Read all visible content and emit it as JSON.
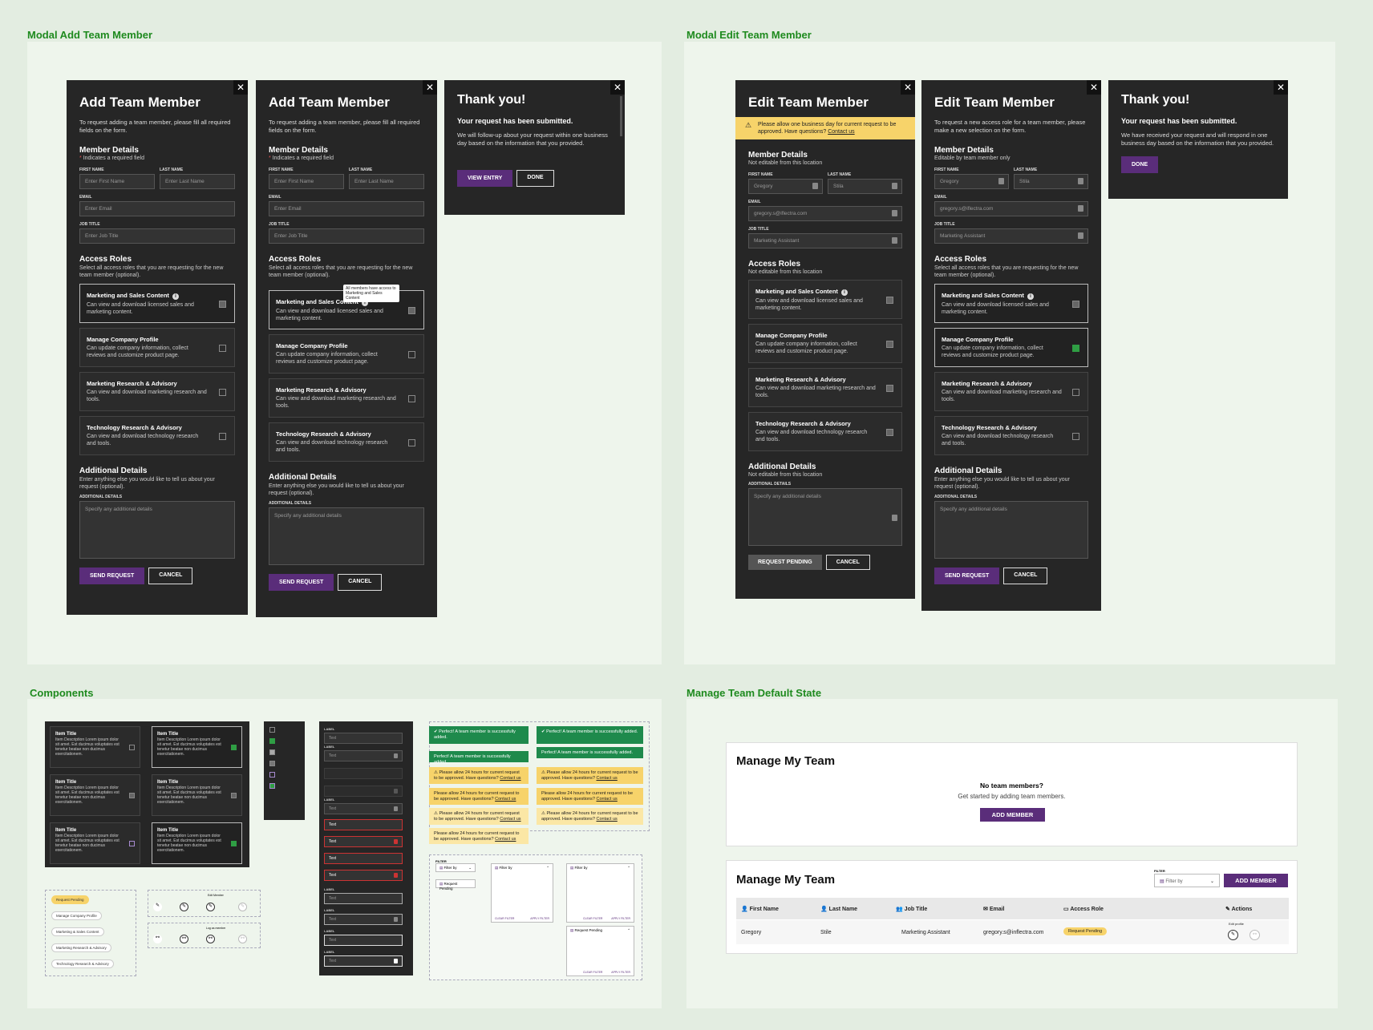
{
  "frames": {
    "add": "Modal Add Team Member",
    "edit": "Modal Edit Team Member",
    "components": "Components",
    "manage": "Manage Team Default State"
  },
  "add_modal": {
    "title": "Add Team Member",
    "subtitle": "To request adding a team member, please fill all required fields on the form.",
    "member_details": "Member Details",
    "required_note": "Indicates a required field",
    "first_name_label": "FIRST NAME",
    "first_name_ph": "Enter First Name",
    "last_name_label": "LAST NAME",
    "last_name_ph": "Enter Last Name",
    "email_label": "EMAIL",
    "email_ph": "Enter Email",
    "job_label": "JOB TITLE",
    "job_ph": "Enter Job Title",
    "access_roles": "Access Roles",
    "access_sub": "Select all access roles that you are requesting for the new team member (optional).",
    "additional": "Additional Details",
    "additional_sub": "Enter anything else you would like to tell us about your request (optional).",
    "additional_label": "ADDITIONAL DETAILS",
    "additional_ph": "Specify any additional details",
    "send": "SEND REQUEST",
    "cancel": "CANCEL",
    "tooltip": "All members have access to Marketing and Sales Content"
  },
  "roles": [
    {
      "title": "Marketing and Sales Content",
      "desc": "Can view and download licensed sales and marketing content."
    },
    {
      "title": "Manage Company Profile",
      "desc": "Can update company information, collect reviews and customize product page."
    },
    {
      "title": "Marketing Research & Advisory",
      "desc": "Can view and download marketing research and tools."
    },
    {
      "title": "Technology Research & Advisory",
      "desc": "Can view and download technology research and tools."
    }
  ],
  "thanks_add": {
    "title": "Thank you!",
    "sub": "Your request has been submitted.",
    "body": "We will follow-up about your request within one business day based on the information that you provided.",
    "view": "VIEW ENTRY",
    "done": "DONE"
  },
  "edit_modal": {
    "title": "Edit Team Member",
    "warning": "Please allow one business day for current request to be approved. Have questions?",
    "contact": "Contact us",
    "subtitle": "To request a new access role for a team member, please make a new selection on the form.",
    "not_editable": "Not editable from this location",
    "editable": "Editable by team member only",
    "first_val": "Gregory",
    "last_val": "Stila",
    "email_val": "gregory.s@iflectra.com",
    "job_val": "Marketing Assistant",
    "pending": "REQUEST PENDING"
  },
  "thanks_edit": {
    "title": "Thank you!",
    "sub": "Your request has been submitted.",
    "body": "We have received your request and will respond in one business day based on the information that you provided.",
    "done": "DONE"
  },
  "components": {
    "item_title": "Item Title",
    "item_desc": "Item Description Lorem ipsum dolor sit amet. Est ducimus voluptates est tenetur beatae non ducimus exercitationem.",
    "success1": "Perfect! A team member is successfully added.",
    "success2": "Perfect! A team member is successfully added.",
    "warn24": "Please allow 24 hours for current request to be approved. Have questions?",
    "contact": "Contact us",
    "tags": [
      "Request Pending",
      "Manage Company Profile",
      "Marketing & Sales Content",
      "Marketing Research & Advisory",
      "Technology Research & Advisory"
    ],
    "edit_member": "Edit Member",
    "log_as_member": "Log as member",
    "field_label": "LABEL",
    "field_text": "Text",
    "filter_label": "FILTER",
    "filter_ph": "Filter by",
    "filter_pending": "Request Pending",
    "clear": "CLEAR FILTER",
    "apply": "APPLY FILTER"
  },
  "manage": {
    "title": "Manage My Team",
    "empty_title": "No team members?",
    "empty_sub": "Get started by adding team members.",
    "add": "ADD MEMBER",
    "filter_label": "FILTER",
    "filter_ph": "Filter by",
    "cols": [
      "First Name",
      "Last Name",
      "Job Title",
      "Email",
      "Access Role",
      "Actions"
    ],
    "row": {
      "first": "Gregory",
      "last": "Stile",
      "job": "Marketing Assistant",
      "email": "gregory.s@inflectra.com",
      "role": "Request Pending"
    },
    "edit_tip": "Edit profile"
  },
  "colors": {
    "accent": "#5a2d7a",
    "success": "#1e8a4c",
    "warning": "#f7d36a",
    "frame_title": "#1e8a1e"
  }
}
